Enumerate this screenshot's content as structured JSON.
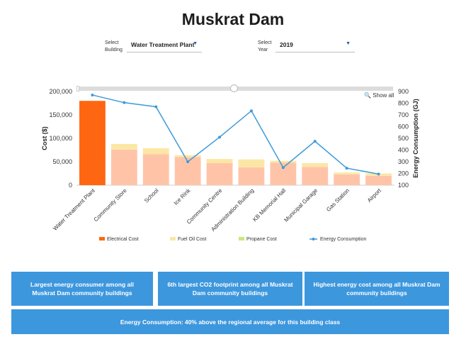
{
  "page": {
    "title": "Muskrat Dam"
  },
  "filters": {
    "building": {
      "label_line1": "Select",
      "label_line2": "Building",
      "value": "Water Treatment Plant"
    },
    "year": {
      "label_line1": "Select",
      "label_line2": "Year",
      "value": "2019"
    }
  },
  "chart_controls": {
    "show_all": "Show all"
  },
  "chart_data": {
    "type": "bar",
    "title": "",
    "categories": [
      "Water Treatment Plant",
      "Community Store",
      "School",
      "Ice Rink",
      "Community Centre",
      "Administration Building",
      "KB Memorial Hall",
      "Municipal Garage",
      "Gas Station",
      "Airport"
    ],
    "series": [
      {
        "name": "Electrical Cost",
        "type": "bar",
        "axis": "left",
        "values": [
          180000,
          76000,
          66000,
          60000,
          47000,
          38000,
          48000,
          39000,
          23000,
          20000
        ]
      },
      {
        "name": "Fuel Oil Cost",
        "type": "bar",
        "axis": "left",
        "values": [
          0,
          12000,
          13000,
          4000,
          9000,
          17000,
          4000,
          8000,
          4000,
          5000
        ]
      },
      {
        "name": "Propane Cost",
        "type": "bar",
        "axis": "left",
        "values": [
          0,
          0,
          0,
          0,
          0,
          0,
          0,
          0,
          0,
          0
        ]
      },
      {
        "name": "Energy Consumption",
        "type": "line",
        "axis": "right",
        "values": [
          870,
          805,
          770,
          300,
          510,
          735,
          250,
          475,
          245,
          195
        ]
      }
    ],
    "ylabel": "Cost ($)",
    "ylabel_right": "Energy Consumption (GJ)",
    "ylim": [
      0,
      200000
    ],
    "ylim_right": [
      100,
      900
    ],
    "yticks": [
      "0",
      "50,000",
      "100,000",
      "150,000",
      "200,000"
    ],
    "yticks_right": [
      "100",
      "200",
      "300",
      "400",
      "500",
      "600",
      "700",
      "800",
      "900"
    ],
    "colors": {
      "selected_bar": "#ff6611",
      "electrical": "#ffc4a8",
      "electrical_legend": "#ff6611",
      "fuel_oil": "#fbe7a5",
      "propane": "#c9e97a",
      "energy_line": "#3d9bd9"
    },
    "legend_position": "bottom",
    "grid": false
  },
  "cards": {
    "card1": "Largest energy consumer among all Muskrat Dam community buildings",
    "card2": "6th largest CO2 footprint among all Muskrat Dam community buildings",
    "card3": "Highest energy cost among all Muskrat Dam community buildings",
    "card4": "Energy Consumption: 40% above the regional average for this building class"
  },
  "colors": {
    "card_bg": "#3d97dd"
  }
}
